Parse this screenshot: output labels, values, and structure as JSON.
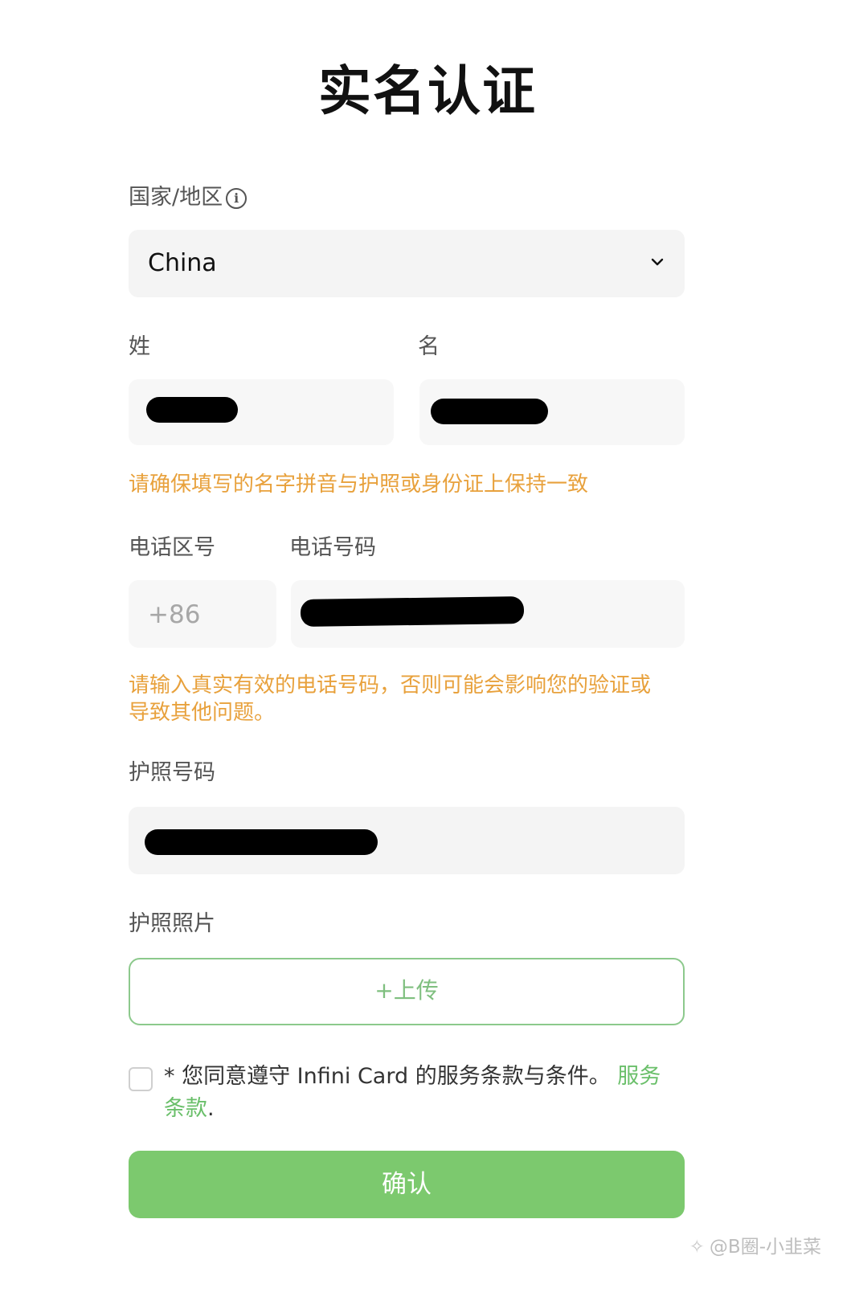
{
  "title": "实名认证",
  "country": {
    "label": "国家/地区",
    "value": "China"
  },
  "surname": {
    "label": "姓"
  },
  "given_name": {
    "label": "名"
  },
  "name_notice": "请确保填写的名字拼音与护照或身份证上保持一致",
  "phone": {
    "code_label": "电话区号",
    "number_label": "电话号码",
    "code_value": "+86",
    "notice_line1": "请输入真实有效的电话号码，否则可能会影响您的验证或",
    "notice_line2": "导致其他问题。"
  },
  "passport_number": {
    "label": "护照号码"
  },
  "passport_photo": {
    "label": "护照照片",
    "upload_label": "+上传"
  },
  "terms": {
    "text": "* 您同意遵守 Infini Card 的服务条款与条件。",
    "link": "服务条款",
    "suffix": "."
  },
  "confirm_label": "确认",
  "watermark": "@B圈-小韭菜",
  "colors": {
    "accent_green": "#7cc96e",
    "warning_orange": "#e8a13c"
  }
}
